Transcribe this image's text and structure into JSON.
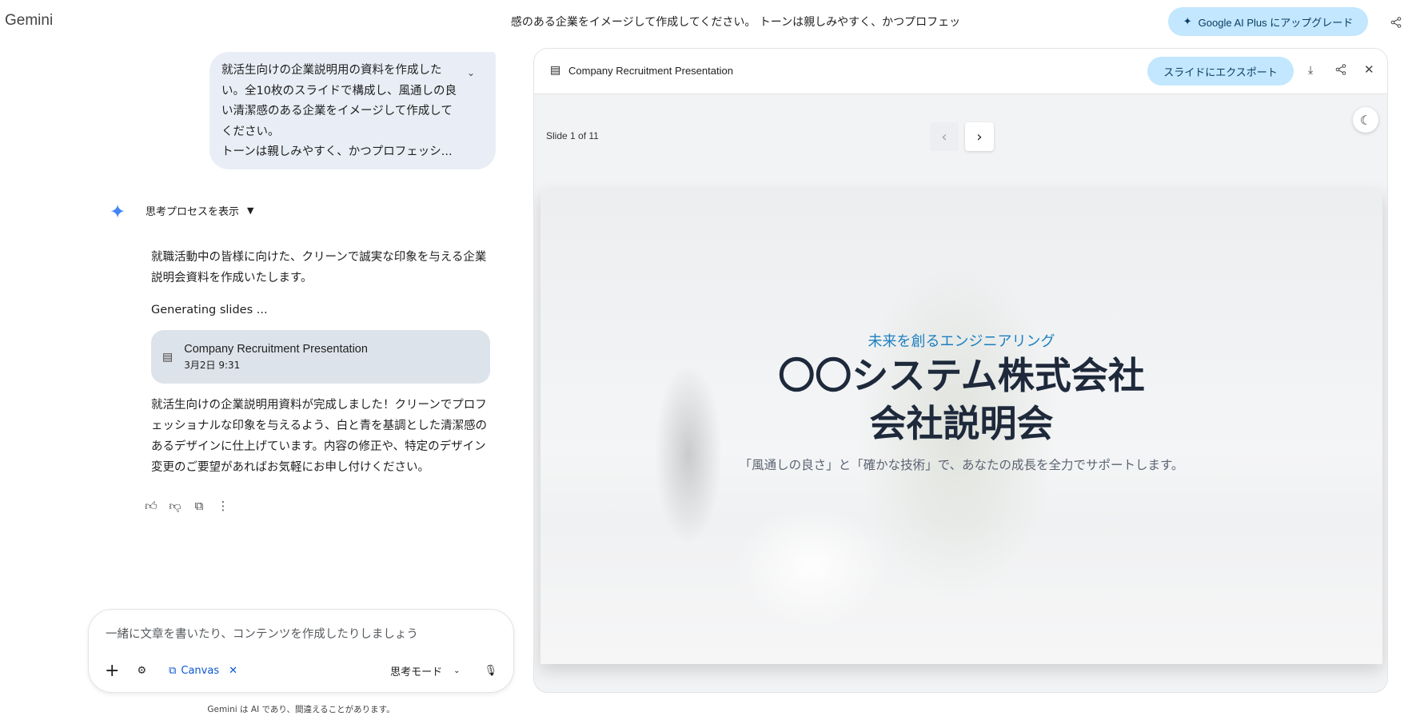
{
  "app": {
    "brand": "Gemini",
    "conversation_title": "感のある企業をイメージして作成してください。 トーンは親しみやすく、かつプロフェッ",
    "upgrade_label": "Google AI Plus にアップグレード"
  },
  "chat": {
    "user_message": "就活生向けの企業説明用の資料を作成したい。全10枚のスライドで構成し、風通しの良い清潔感のある企業をイメージして作成してください。\nトーンは親しみやすく、かつプロフェッシ...",
    "thinking_label": "思考プロセスを表示",
    "response_intro": "就職活動中の皆様に向けた、クリーンで誠実な印象を与える企業説明会資料を作成いたします。",
    "generating": "Generating slides ...",
    "card": {
      "title": "Company Recruitment Presentation",
      "date": "3月2日 9:31"
    },
    "response_done": "就活生向けの企業説明用資料が完成しました！クリーンでプロフェッショナルな印象を与えるよう、白と青を基調とした清潔感のあるデザインに仕上げています。内容の修正や、特定のデザイン変更のご要望があればお気軽にお申し付けください。"
  },
  "input": {
    "placeholder": "一緒に文章を書いたり、コンテンツを作成したりしましょう",
    "canvas_label": "Canvas",
    "mode_label": "思考モード",
    "footer": "Gemini は AI であり、間違えることがあります。"
  },
  "panel": {
    "title": "Company Recruitment Presentation",
    "export_label": "スライドにエクスポート",
    "slide_counter": "Slide 1 of 11",
    "slide": {
      "tagline": "未来を創るエンジニアリング",
      "title_line1": "〇〇システム株式会社",
      "title_line2": "会社説明会",
      "subtitle": "「風通しの良さ」と「確かな技術」で、あなたの成長を全力でサポートします。"
    }
  },
  "colors": {
    "accent": "#c2e7ff",
    "link": "#0b57d0",
    "slide_tagline": "#1a7fc0",
    "slide_title": "#1e293b"
  }
}
